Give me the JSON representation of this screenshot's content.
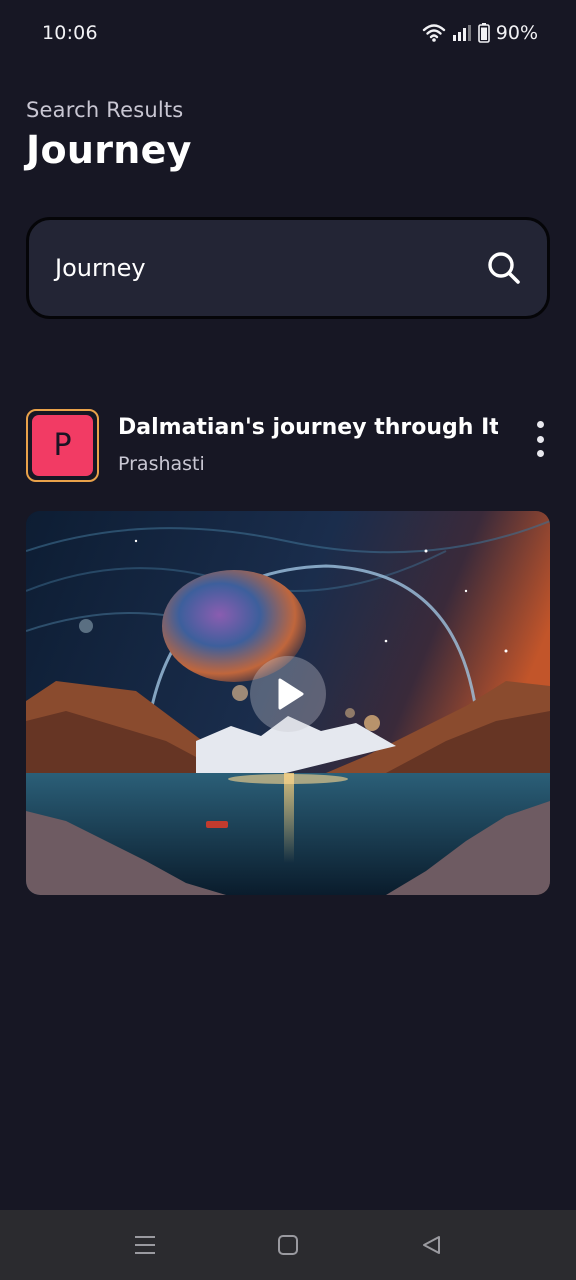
{
  "status_bar": {
    "time": "10:06",
    "battery": "90%",
    "icons": [
      "wifi-icon",
      "signal-icon",
      "battery-icon"
    ]
  },
  "header": {
    "subtitle": "Search Results",
    "title": "Journey"
  },
  "search": {
    "value": "Journey",
    "icon": "search-icon"
  },
  "results": [
    {
      "avatar_letter": "P",
      "title": "Dalmatian's journey through It...",
      "author": "Prashasti",
      "menu_icon": "more-vertical-icon",
      "play_icon": "play-icon"
    }
  ],
  "nav_bar": {
    "icons": [
      "menu-icon",
      "home-icon",
      "back-icon"
    ]
  },
  "colors": {
    "background": "#171724",
    "search_bg": "#232535",
    "avatar_bg": "#f23b64",
    "avatar_border": "#e9a24a",
    "nav_bg": "#2b2b2f"
  }
}
